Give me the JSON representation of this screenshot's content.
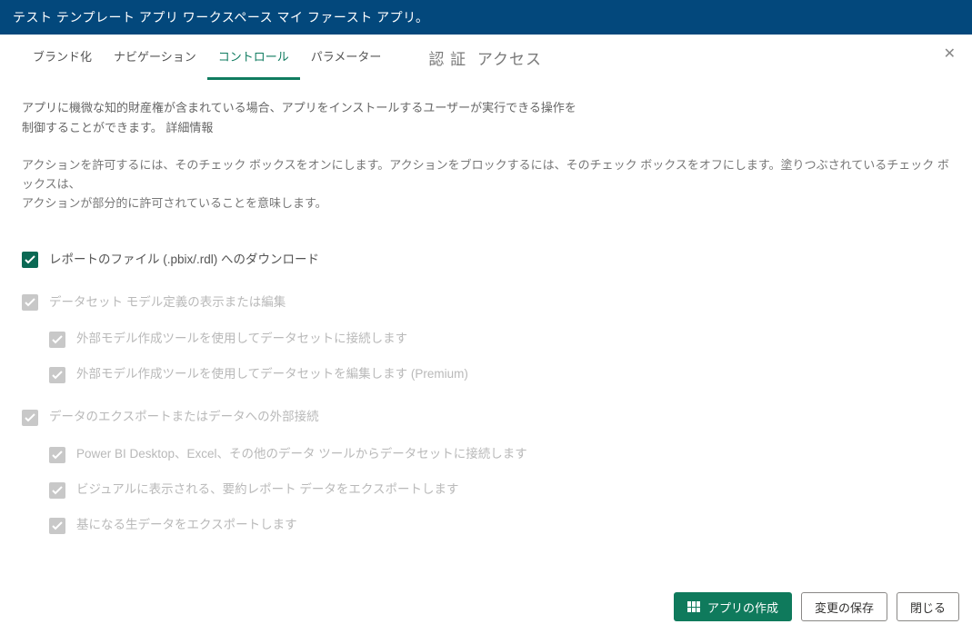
{
  "header": {
    "title": "テスト テンプレート アプリ ワークスペース マイ ファースト アプリ。"
  },
  "tabs": {
    "branding": "ブランド化",
    "navigation": "ナビゲーション",
    "control": "コントロール",
    "parameter": "パラメーター",
    "auth": "認 証",
    "access": "アクセス"
  },
  "intro": {
    "line1": "アプリに機微な知的財産権が含まれている場合、アプリをインストールするユーザーが実行できる操作を",
    "line2_prefix": "制御することができます。",
    "more": "詳細情報"
  },
  "note": {
    "line1": "アクションを許可するには、そのチェック ボックスをオンにします。アクションをブロックするには、そのチェック ボックスをオフにします。塗りつぶされているチェック ボックスは、",
    "line2": "アクションが部分的に許可されていることを意味します。"
  },
  "checks": {
    "download": "レポートのファイル (.pbix/.rdl) へのダウンロード",
    "dataset_group": "データセット モデル定義の表示または編集",
    "dataset_sub1": "外部モデル作成ツールを使用してデータセットに接続します",
    "dataset_sub2": "外部モデル作成ツールを使用してデータセットを編集します (Premium)",
    "export_group": "データのエクスポートまたはデータへの外部接続",
    "export_sub1": "Power BI Desktop、Excel、その他のデータ ツールからデータセットに接続します",
    "export_sub2": "ビジュアルに表示される、要約レポート データをエクスポートします",
    "export_sub3": "基になる生データをエクスポートします"
  },
  "footer": {
    "create": "アプリの作成",
    "save": "変更の保存",
    "close": "閉じる"
  }
}
